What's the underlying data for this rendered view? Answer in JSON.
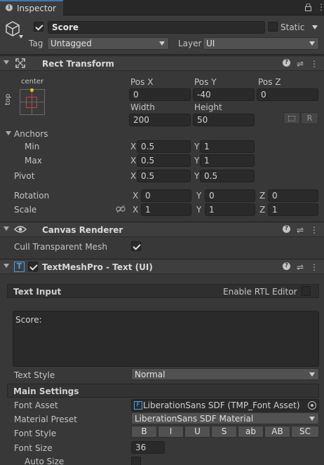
{
  "tab": {
    "label": "Inspector"
  },
  "gameobject": {
    "active": true,
    "name": "Score",
    "static_label": "Static",
    "static_checked": false,
    "tag_label": "Tag",
    "tag_value": "Untagged",
    "layer_label": "Layer",
    "layer_value": "UI"
  },
  "rect_transform": {
    "title": "Rect Transform",
    "anchor_preset_top": "center",
    "anchor_preset_side": "top",
    "pos_x_label": "Pos X",
    "pos_x": "0",
    "pos_y_label": "Pos Y",
    "pos_y": "-40",
    "pos_z_label": "Pos Z",
    "pos_z": "0",
    "width_label": "Width",
    "width": "200",
    "height_label": "Height",
    "height": "50",
    "r_button": "R",
    "anchors_label": "Anchors",
    "min_label": "Min",
    "min_x": "0.5",
    "min_y": "1",
    "max_label": "Max",
    "max_x": "0.5",
    "max_y": "1",
    "pivot_label": "Pivot",
    "pivot_x": "0.5",
    "pivot_y": "0.5",
    "rotation_label": "Rotation",
    "rot_x": "0",
    "rot_y": "0",
    "rot_z": "0",
    "scale_label": "Scale",
    "scale_x": "1",
    "scale_y": "1",
    "scale_z": "1",
    "x": "X",
    "y": "Y",
    "z": "Z"
  },
  "canvas_renderer": {
    "title": "Canvas Renderer",
    "cull_label": "Cull Transparent Mesh",
    "cull_checked": true
  },
  "tmp": {
    "title": "TextMeshPro - Text (UI)",
    "enabled": true,
    "text_input_label": "Text Input",
    "rtl_label": "Enable RTL Editor",
    "text_value": "Score:",
    "text_style_label": "Text Style",
    "text_style_value": "Normal",
    "main_settings_label": "Main Settings",
    "font_asset_label": "Font Asset",
    "font_asset_value": "LiberationSans SDF (TMP_Font Asset)",
    "material_preset_label": "Material Preset",
    "material_preset_value": "LiberationSans SDF Material",
    "font_style_label": "Font Style",
    "font_style_buttons": [
      "B",
      "I",
      "U",
      "S",
      "ab",
      "AB",
      "SC"
    ],
    "font_size_label": "Font Size",
    "font_size_value": "36",
    "auto_size_label": "Auto Size"
  }
}
